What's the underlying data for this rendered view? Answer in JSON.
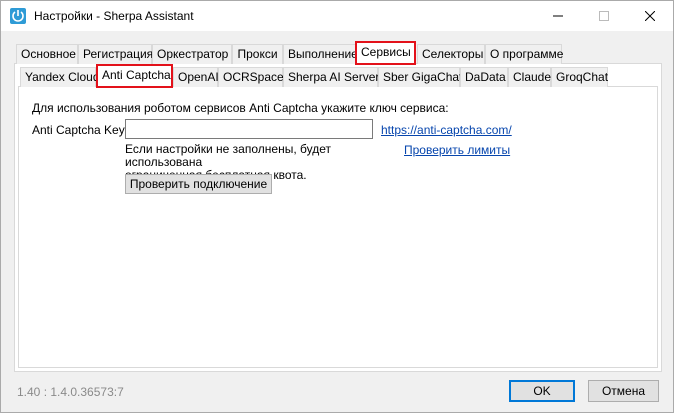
{
  "window": {
    "title": "Настройки - Sherpa Assistant"
  },
  "main_tabs": [
    {
      "label": "Основное"
    },
    {
      "label": "Регистрация"
    },
    {
      "label": "Оркестратор"
    },
    {
      "label": "Прокси"
    },
    {
      "label": "Выполнение"
    },
    {
      "label": "Сервисы"
    },
    {
      "label": "Селекторы"
    },
    {
      "label": "О программе"
    }
  ],
  "service_tabs": [
    {
      "label": "Yandex Cloud"
    },
    {
      "label": "Anti Captcha"
    },
    {
      "label": "OpenAI"
    },
    {
      "label": "OCRSpace"
    },
    {
      "label": "Sherpa AI Server"
    },
    {
      "label": "Sber GigaChat"
    },
    {
      "label": "DaData"
    },
    {
      "label": "Claude"
    },
    {
      "label": "GroqChat"
    }
  ],
  "anti_captcha": {
    "description": "Для использования роботом сервисов Anti Captcha укажите ключ сервиса:",
    "key_label": "Anti Captcha Key:",
    "key_value": "",
    "site_link": "https://anti-captcha.com/",
    "note_line1": "Если настройки не заполнены, будет использована",
    "note_line2": "ограниченная бесплатная квота.",
    "limits_link": "Проверить лимиты",
    "check_button": "Проверить подключение"
  },
  "footer": {
    "version": "1.40 : 1.4.0.36573:7",
    "ok_label": "OK",
    "cancel_label": "Отмена"
  },
  "colors": {
    "highlight": "#e3111a",
    "link": "#0645ad",
    "accent": "#0078d7"
  }
}
